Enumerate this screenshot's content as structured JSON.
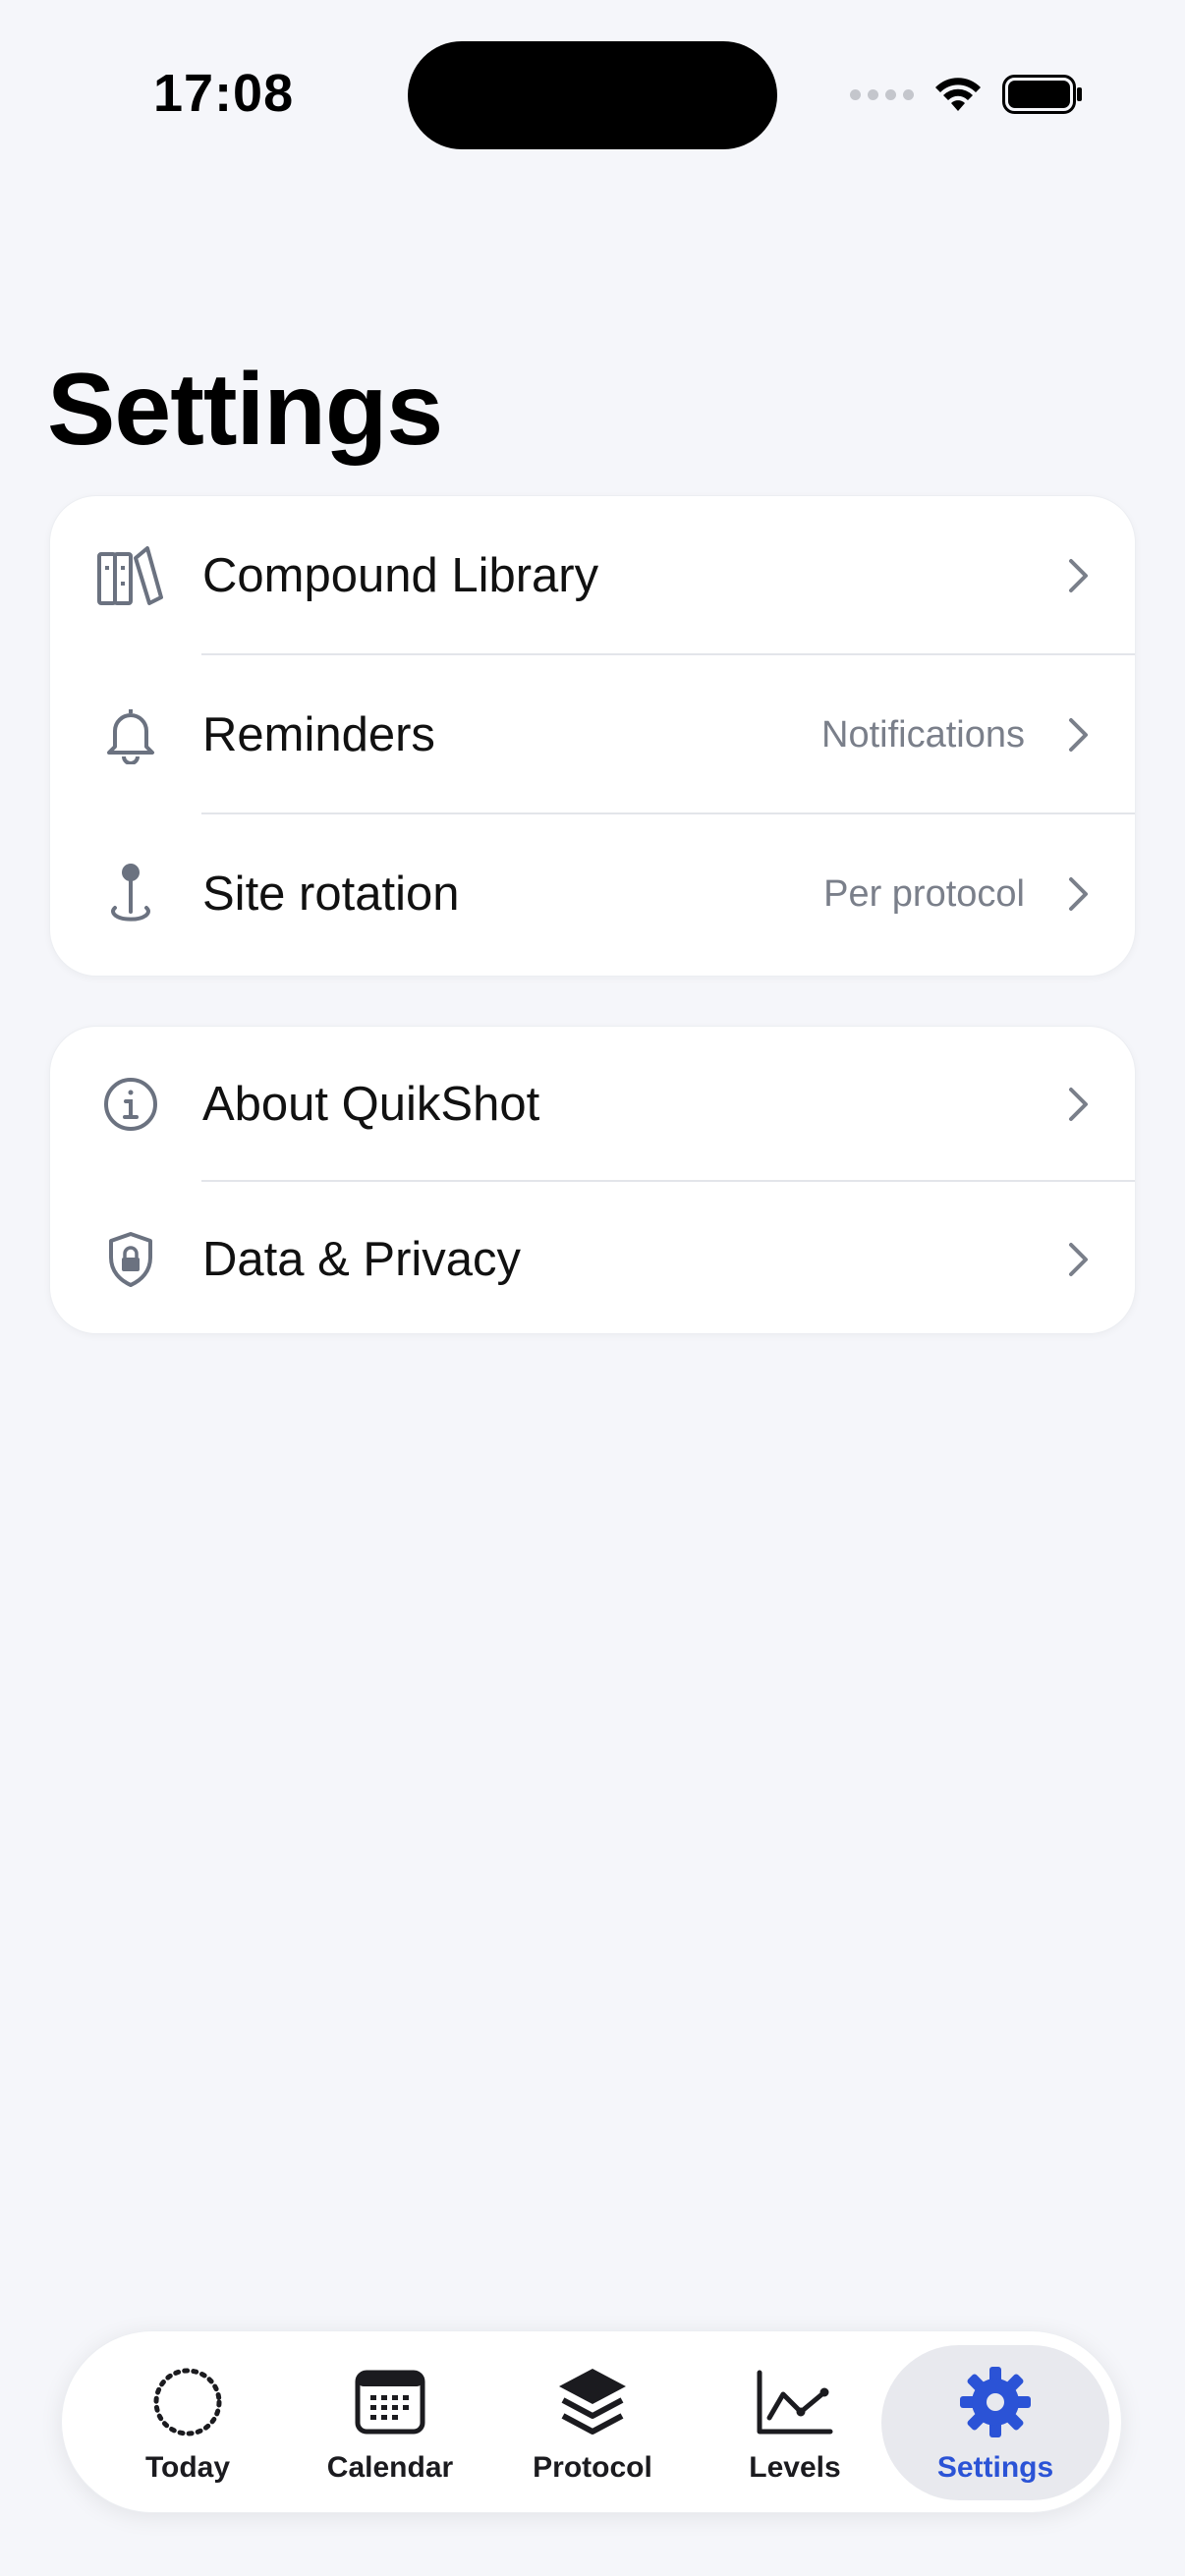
{
  "status_bar": {
    "time": "17:08"
  },
  "page": {
    "title": "Settings"
  },
  "sections": [
    {
      "rows": [
        {
          "label": "Compound Library",
          "detail": "",
          "icon": "books-icon"
        },
        {
          "label": "Reminders",
          "detail": "Notifications",
          "icon": "bell-icon"
        },
        {
          "label": "Site rotation",
          "detail": "Per protocol",
          "icon": "map-pin-icon"
        }
      ]
    },
    {
      "rows": [
        {
          "label": "About QuikShot",
          "detail": "",
          "icon": "info-icon"
        },
        {
          "label": "Data & Privacy",
          "detail": "",
          "icon": "shield-lock-icon"
        }
      ]
    }
  ],
  "tabbar": {
    "active": "Settings",
    "tabs": [
      {
        "label": "Today",
        "icon": "dotted-circle-icon"
      },
      {
        "label": "Calendar",
        "icon": "calendar-icon"
      },
      {
        "label": "Protocol",
        "icon": "layers-icon"
      },
      {
        "label": "Levels",
        "icon": "line-chart-icon"
      },
      {
        "label": "Settings",
        "icon": "gear-icon"
      }
    ]
  },
  "colors": {
    "background": "#f5f6fa",
    "accent": "#2b53d6",
    "icon_gray": "#6b7280",
    "detail_gray": "#7a7f8a"
  }
}
